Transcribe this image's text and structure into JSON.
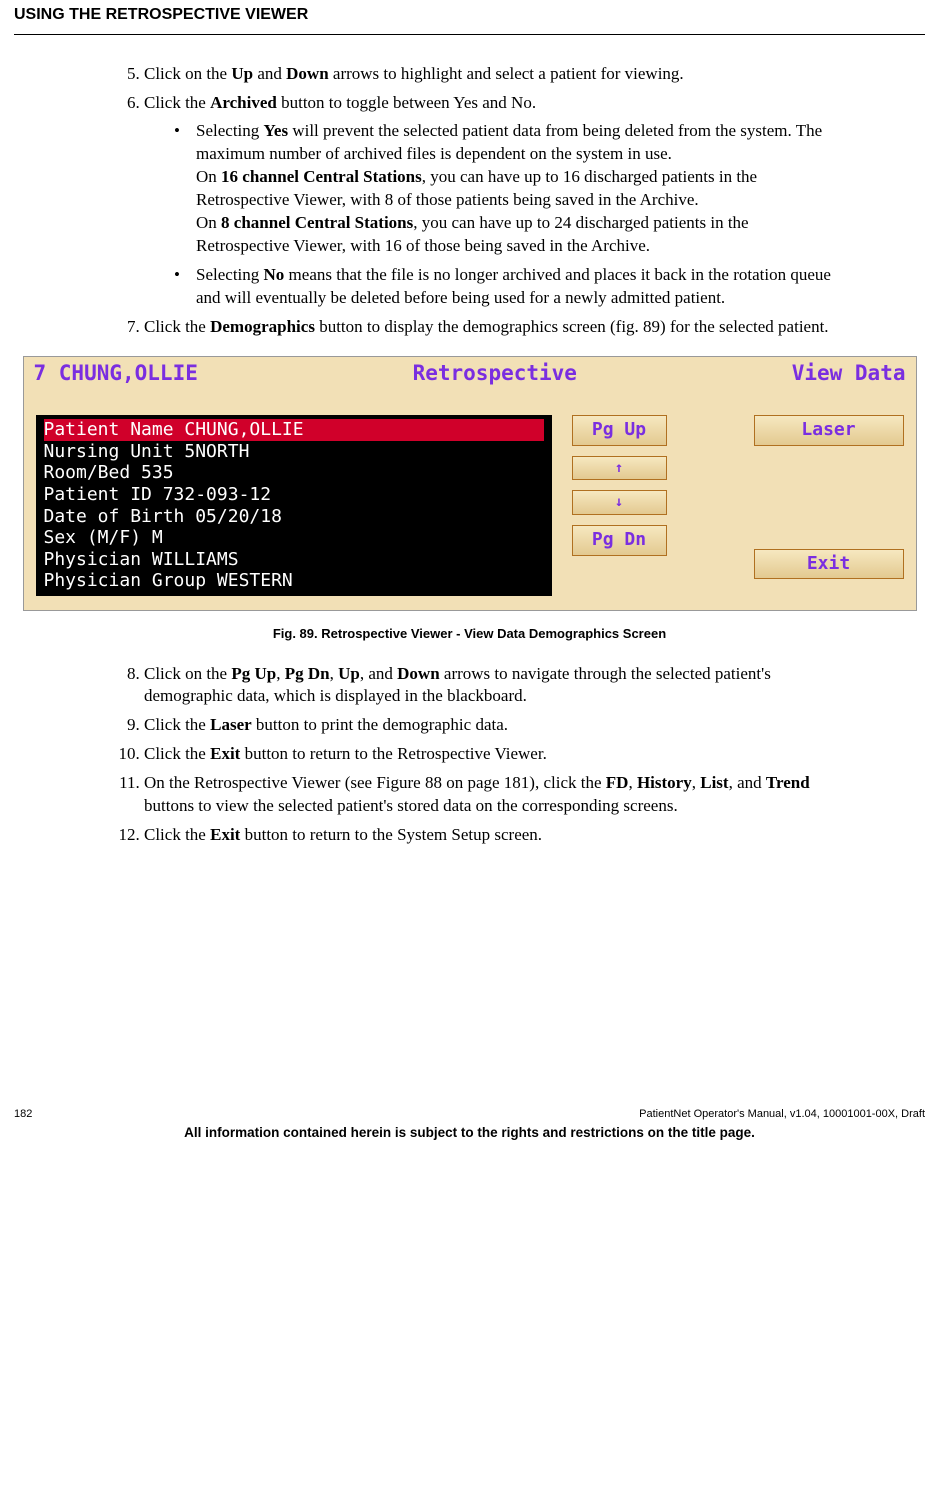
{
  "header": "USING THE RETROSPECTIVE VIEWER",
  "li5_a": "Click on the ",
  "li5_b1": "Up",
  "li5_c": " and ",
  "li5_b2": "Down",
  "li5_d": " arrows to highlight and select a patient for viewing.",
  "li6_a": "Click the ",
  "li6_b": "Archived",
  "li6_c": " button to toggle between Yes and No.",
  "s1_a": "Selecting ",
  "s1_b": "Yes",
  "s1_c": " will prevent the selected patient data from being deleted from the system. The maximum number of archived files is dependent on the system in use.",
  "s1_p2a": "On ",
  "s1_p2b": "16 channel Central Stations",
  "s1_p2c": ", you can have up to 16 discharged patients in the Retrospective Viewer, with 8 of those patients being saved in the Archive.",
  "s1_p3a": "On ",
  "s1_p3b": "8 channel Central Stations",
  "s1_p3c": ", you can have up to 24 discharged patients in the Retrospective Viewer, with 16 of those being saved in the Archive.",
  "s2_a": "Selecting ",
  "s2_b": "No",
  "s2_c": " means that the file is no longer archived and places it back in the rotation queue and will eventually be deleted before being used for a newly admitted patient.",
  "li7_a": "Click the ",
  "li7_b": "Demographics",
  "li7_c": " button to display the demographics screen (fig. 89) for the selected patient.",
  "title_left": "7  CHUNG,OLLIE",
  "title_mid": "Retrospective",
  "title_right": "View Data",
  "row1": "Patient  Name     CHUNG,OLLIE",
  "row2": "Nursing  Unit     5NORTH",
  "row3": "Room/Bed          535",
  "row4": "Patient  ID       732-093-12",
  "row5": "Date of Birth     05/20/18",
  "row6": "Sex (M/F)         M",
  "row7": "Physician         WILLIAMS",
  "row8": "Physician  Group  WESTERN",
  "btn_pgup": "Pg Up",
  "btn_up": "↑",
  "btn_dn": "↓",
  "btn_pgdn": "Pg Dn",
  "btn_laser": "Laser",
  "btn_exit": "Exit",
  "caption": "Fig. 89. Retrospective Viewer - View Data Demographics Screen",
  "li8_a": "Click on the ",
  "li8_b1": "Pg Up",
  "li8_c1": ", ",
  "li8_b2": "Pg Dn",
  "li8_c2": ", ",
  "li8_b3": "Up",
  "li8_c3": ", and ",
  "li8_b4": "Down",
  "li8_d": " arrows to navigate through the selected patient's demographic data, which is displayed in the blackboard.",
  "li9_a": "Click the ",
  "li9_b": "Laser",
  "li9_c": " button to print the demographic data.",
  "li10_a": "Click the ",
  "li10_b": "Exit",
  "li10_c": " button to return to the Retrospective Viewer.",
  "li11_a": "On the Retrospective Viewer (see Figure 88 on page 181), click the ",
  "li11_b1": "FD",
  "li11_c1": ", ",
  "li11_b2": "History",
  "li11_c2": ", ",
  "li11_b3": "List",
  "li11_c3": ", and ",
  "li11_b4": "Trend",
  "li11_d": " buttons to view the selected patient's stored data on the corresponding screens.",
  "li12_a": "Click the ",
  "li12_b": "Exit",
  "li12_c": " button to return to the System Setup screen.",
  "pagenum": "182",
  "docid": "PatientNet Operator's Manual, v1.04, 10001001-00X, Draft",
  "footnote": "All information contained herein is subject to the rights and restrictions on the title page."
}
